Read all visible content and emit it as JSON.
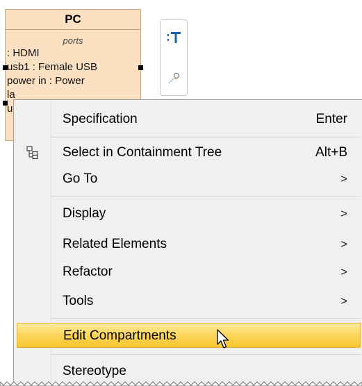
{
  "block": {
    "name": "PC",
    "compartment_title": "ports",
    "ports": [
      ": HDMI",
      "usb1 : Female USB",
      "power in : Power",
      "la",
      "u"
    ]
  },
  "toolbar": {
    "buttons": [
      {
        "icon": "text-icon",
        "glyph": ":T"
      },
      {
        "icon": "pin-icon"
      }
    ]
  },
  "menu": {
    "items": [
      {
        "label": "Specification",
        "shortcut": "Enter"
      },
      {
        "label": "Select in Containment Tree",
        "shortcut": "Alt+B",
        "icon": "containment-tree-icon"
      },
      {
        "label": "Go To",
        "arrow": ">"
      },
      {
        "label": "Display",
        "arrow": ">"
      },
      {
        "label": "Related Elements",
        "arrow": ">"
      },
      {
        "label": "Refactor",
        "arrow": ">"
      },
      {
        "label": "Tools",
        "arrow": ">"
      },
      {
        "label": "Edit Compartments"
      },
      {
        "label": "Stereotype"
      }
    ]
  },
  "colors": {
    "block_fill": "#fbe0c1",
    "menu_bg": "#f0f0f0",
    "highlight": "#fdd55b"
  }
}
